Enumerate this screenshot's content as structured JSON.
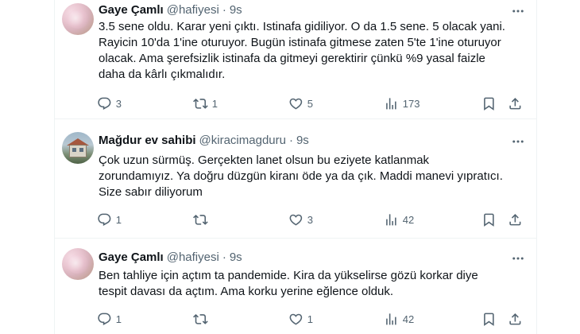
{
  "tweets": [
    {
      "display_name": "Gaye Çamlı",
      "handle": "@hafiyesi",
      "separator": "·",
      "time": "9s",
      "lines": [
        "3.5 sene oldu. Karar yeni çıktı. Istinafa gidiliyor. O da 1.5 sene. 5 olacak yani.",
        "Rayicin 10'da 1'ine oturuyor. Bugün istinafa gitmese zaten 5'te 1'ine oturuyor",
        "olacak. Ama şerefsizlik istinafa da gitmeyi gerektirir çünkü %9 yasal faizle",
        "daha da kârlı çıkmalıdır."
      ],
      "replies": "3",
      "retweets": "1",
      "likes": "5",
      "views": "173",
      "avatar_icon": "cherry-blossom-avatar"
    },
    {
      "display_name": "Mağdur ev sahibi",
      "handle": "@kiracimagduru",
      "separator": "·",
      "time": "9s",
      "lines": [
        "Çok uzun sürmüş. Gerçekten lanet olsun bu eziyete katlanmak",
        "zorundamıyız. Ya doğru düzgün kiranı öde ya da çık. Maddi manevi yıpratıcı.",
        "Size sabır diliyorum"
      ],
      "replies": "1",
      "retweets": "",
      "likes": "3",
      "views": "42",
      "avatar_icon": "house-avatar"
    },
    {
      "display_name": "Gaye Çamlı",
      "handle": "@hafiyesi",
      "separator": "·",
      "time": "9s",
      "lines": [
        "Ben tahliye için açtım ta pandemide. Kira da yükselirse gözü korkar diye",
        "tespit davası da açtım. Ama korku yerine eğlence olduk."
      ],
      "replies": "1",
      "retweets": "",
      "likes": "1",
      "views": "42",
      "avatar_icon": "cherry-blossom-avatar"
    }
  ],
  "icons": {
    "reply": "reply-icon",
    "retweet": "retweet-icon",
    "like": "heart-icon",
    "views": "views-chart-icon",
    "bookmark": "bookmark-icon",
    "share": "share-icon",
    "more": "more-icon"
  },
  "colors": {
    "text": "#0f1419",
    "secondary": "#536471",
    "border": "#eff3f4",
    "background": "#ffffff"
  }
}
